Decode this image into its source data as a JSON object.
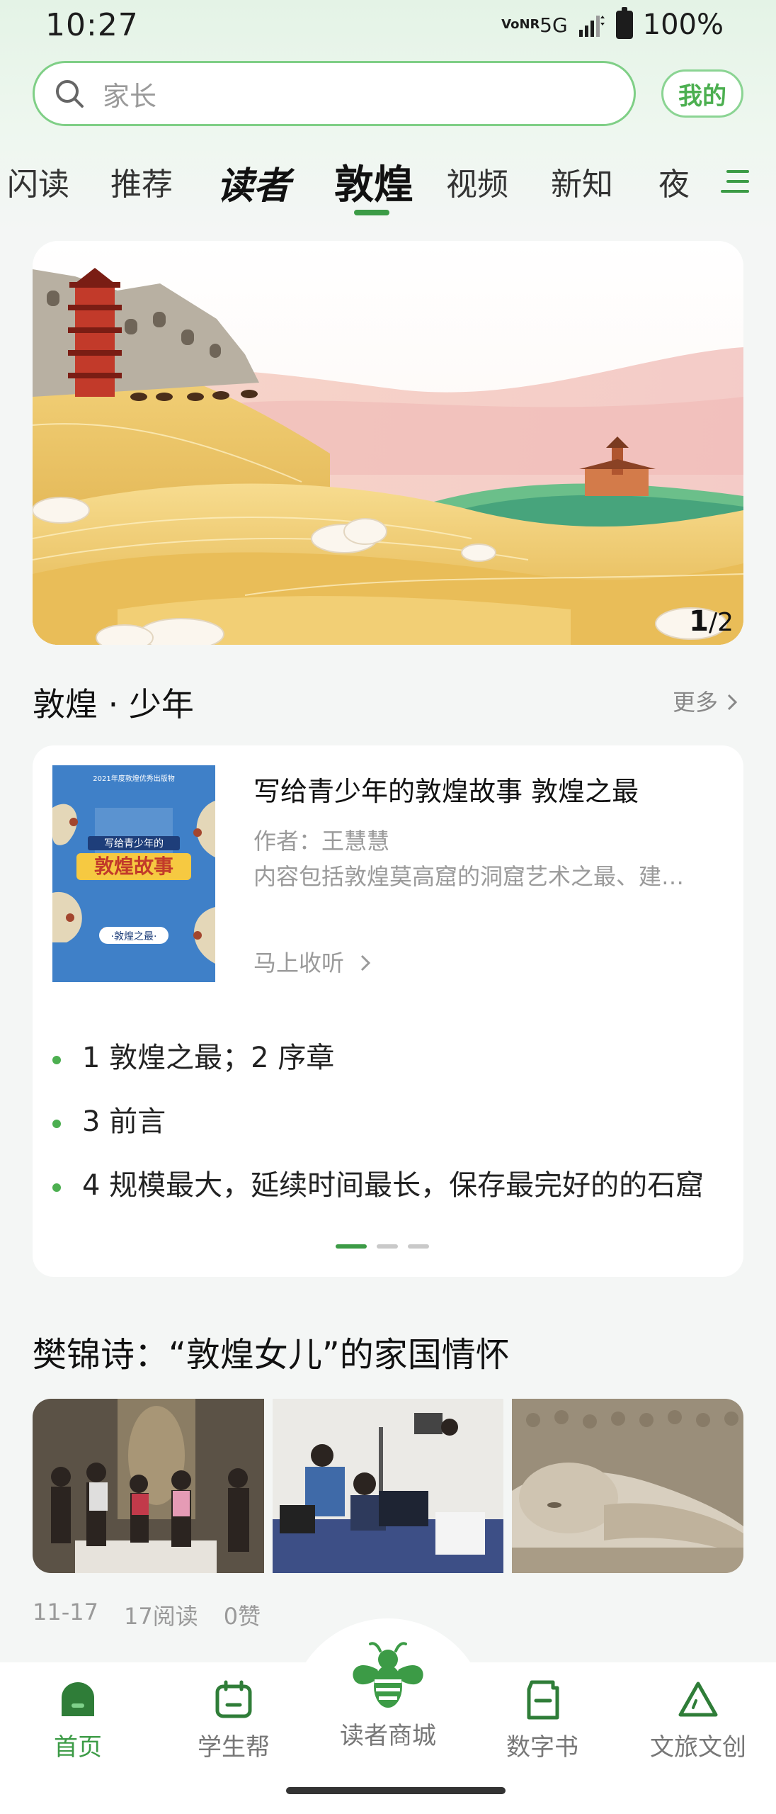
{
  "status_bar": {
    "time": "10:27",
    "vonr": "VoNR",
    "network": "5G",
    "battery": "100%"
  },
  "search": {
    "placeholder": "家长"
  },
  "header": {
    "mine_label": "我的"
  },
  "tabs": [
    {
      "label": "闪读"
    },
    {
      "label": "推荐"
    },
    {
      "label": "读者"
    },
    {
      "label": "敦煌",
      "active": true
    },
    {
      "label": "视频"
    },
    {
      "label": "新知"
    },
    {
      "label": "夜"
    }
  ],
  "banner": {
    "current": "1",
    "total": "/2"
  },
  "section": {
    "title": "敦煌 · 少年",
    "more_label": "更多"
  },
  "book": {
    "title": "写给青少年的敦煌故事 敦煌之最",
    "author": "作者：王慧慧",
    "description": "内容包括敦煌莫高窟的洞窟艺术之最、建…",
    "listen_label": "马上收听",
    "cover": {
      "top_line": "2021年度敦煌优秀出版物",
      "subtitle": "写给青少年的",
      "main_title": "敦煌故事",
      "bottom_title": "·敦煌之最·"
    },
    "chapters": [
      "1 敦煌之最；2 序章",
      "3 前言",
      "4 规模最大，延续时间最长，保存最完好的的石窟"
    ],
    "pager_dots": 3,
    "pager_active": 0
  },
  "article": {
    "title": "樊锦诗：“敦煌女儿”的家国情怀",
    "date": "11-17",
    "reads": "17阅读",
    "likes": "0赞"
  },
  "bottom_nav": [
    {
      "label": "首页",
      "icon": "home-icon",
      "active": true
    },
    {
      "label": "学生帮",
      "icon": "student-icon"
    },
    {
      "label": "读者商城",
      "icon": "bee-icon"
    },
    {
      "label": "数字书",
      "icon": "book-icon"
    },
    {
      "label": "文旅文创",
      "icon": "triangle-icon"
    }
  ],
  "colors": {
    "accent": "#3c9b46",
    "accent_light": "#7fcf86",
    "background": "#f4f6f5"
  }
}
